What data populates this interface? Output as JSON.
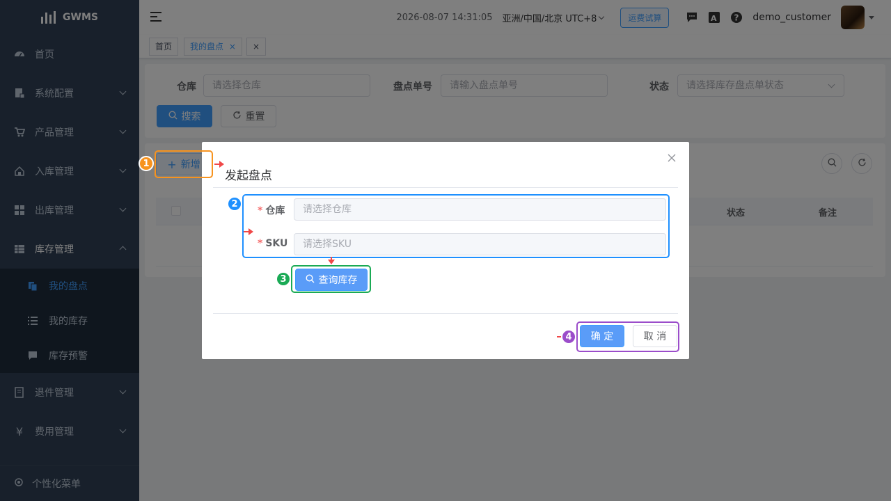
{
  "brand": {
    "name": "GWMS"
  },
  "sidebar": {
    "items": [
      {
        "label": "首页",
        "icon": "dashboard-icon"
      },
      {
        "label": "系统配置",
        "icon": "settings-doc-icon"
      },
      {
        "label": "产品管理",
        "icon": "cart-icon"
      },
      {
        "label": "入库管理",
        "icon": "home-icon"
      },
      {
        "label": "出库管理",
        "icon": "grid-icon"
      },
      {
        "label": "库存管理",
        "icon": "table-icon"
      },
      {
        "label": "退件管理",
        "icon": "return-icon"
      },
      {
        "label": "费用管理",
        "icon": "yen-icon"
      }
    ],
    "subitems": [
      {
        "label": "我的盘点",
        "icon": "copy-icon",
        "active": true
      },
      {
        "label": "我的库存",
        "icon": "list-icon"
      },
      {
        "label": "库存预警",
        "icon": "message-icon"
      }
    ],
    "footer": "个性化菜单"
  },
  "header": {
    "datetime": "2026-08-07 14:31:05",
    "timezone": "亚洲/中国/北京 UTC+8",
    "fee_button": "运费试算",
    "username": "demo_customer"
  },
  "tags": {
    "home": "首页",
    "current": "我的盘点"
  },
  "search": {
    "warehouse_label": "仓库",
    "warehouse_placeholder": "请选择仓库",
    "order_label": "盘点单号",
    "order_placeholder": "请输入盘点单号",
    "status_label": "状态",
    "status_placeholder": "请选择库存盘点单状态",
    "search_button": "搜索",
    "reset_button": "重置"
  },
  "toolbar": {
    "add_button": "新增"
  },
  "table": {
    "columns": [
      "状态",
      "备注"
    ]
  },
  "dialog": {
    "title": "发起盘点",
    "warehouse_label": "仓库",
    "warehouse_placeholder": "请选择仓库",
    "sku_label": "SKU",
    "sku_placeholder": "请选择SKU",
    "query_button": "查询库存",
    "confirm_button": "确 定",
    "cancel_button": "取 消"
  },
  "annotations": [
    {
      "number": "1",
      "color": "#f7931e"
    },
    {
      "number": "2",
      "color": "#1e90ff"
    },
    {
      "number": "3",
      "color": "#1aaa55"
    },
    {
      "number": "4",
      "color": "#9b4dca"
    }
  ]
}
